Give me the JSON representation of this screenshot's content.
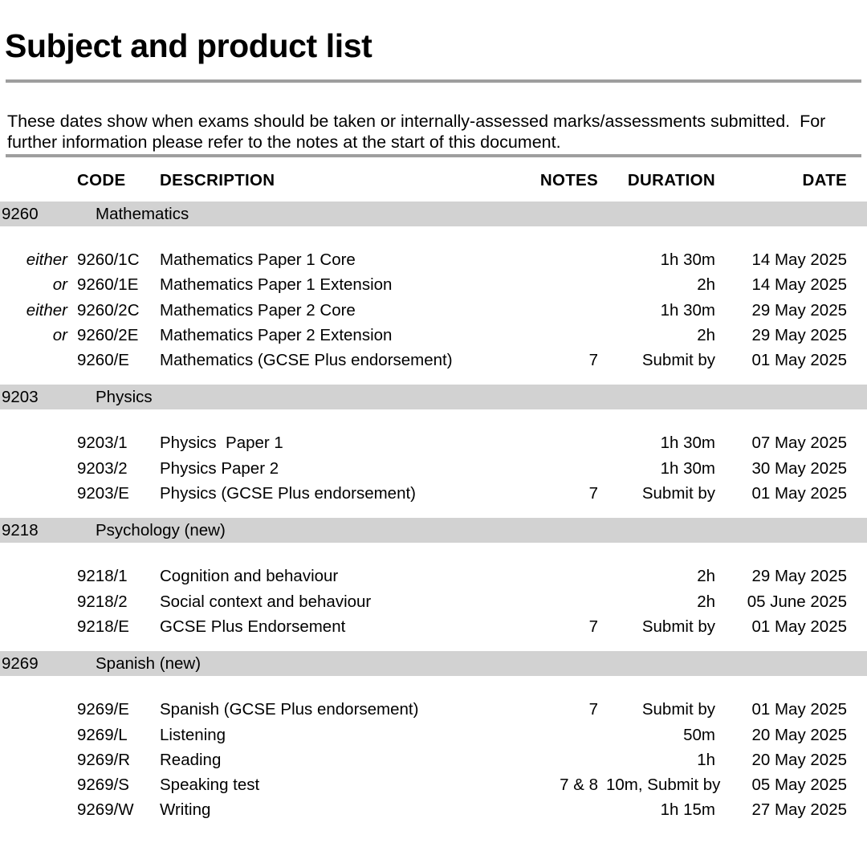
{
  "document": {
    "title": "Subject and product list",
    "intro": "These dates show when exams should be taken or internally-assessed marks/assessments submitted.  For further information please refer to the notes at the start of this document.",
    "band_color": "#d2d2d2",
    "rule_color": "#9e9e9e"
  },
  "table": {
    "headers": {
      "either": "",
      "code": "CODE",
      "description": "DESCRIPTION",
      "notes": "NOTES",
      "duration": "DURATION",
      "date": "DATE"
    },
    "sections": [
      {
        "subject_code": "9260",
        "subject_name": "Mathematics",
        "rows": [
          {
            "either": "either",
            "code": "9260/1C",
            "description": "Mathematics Paper 1 Core",
            "notes": "",
            "duration": "1h 30m",
            "date": "14 May 2025"
          },
          {
            "either": "or",
            "code": "9260/1E",
            "description": "Mathematics Paper 1 Extension",
            "notes": "",
            "duration": "2h",
            "date": "14 May 2025"
          },
          {
            "either": "either",
            "code": "9260/2C",
            "description": "Mathematics Paper 2 Core",
            "notes": "",
            "duration": "1h 30m",
            "date": "29 May 2025"
          },
          {
            "either": "or",
            "code": "9260/2E",
            "description": "Mathematics Paper 2 Extension",
            "notes": "",
            "duration": "2h",
            "date": "29 May 2025"
          },
          {
            "either": "",
            "code": "9260/E",
            "description": "Mathematics (GCSE Plus endorsement)",
            "notes": "7",
            "duration": "Submit by",
            "date": "01 May 2025"
          }
        ]
      },
      {
        "subject_code": "9203",
        "subject_name": "Physics",
        "rows": [
          {
            "either": "",
            "code": "9203/1",
            "description": "Physics  Paper 1",
            "notes": "",
            "duration": "1h 30m",
            "date": "07 May 2025"
          },
          {
            "either": "",
            "code": "9203/2",
            "description": "Physics Paper 2",
            "notes": "",
            "duration": "1h 30m",
            "date": "30 May 2025"
          },
          {
            "either": "",
            "code": "9203/E",
            "description": "Physics (GCSE Plus endorsement)",
            "notes": "7",
            "duration": "Submit by",
            "date": "01 May 2025"
          }
        ]
      },
      {
        "subject_code": "9218",
        "subject_name": "Psychology (new)",
        "rows": [
          {
            "either": "",
            "code": "9218/1",
            "description": "Cognition and behaviour",
            "notes": "",
            "duration": "2h",
            "date": "29 May 2025"
          },
          {
            "either": "",
            "code": "9218/2",
            "description": "Social context and behaviour",
            "notes": "",
            "duration": "2h",
            "date": "05 June 2025"
          },
          {
            "either": "",
            "code": "9218/E",
            "description": "GCSE Plus Endorsement",
            "notes": "7",
            "duration": "Submit by",
            "date": "01 May 2025"
          }
        ]
      },
      {
        "subject_code": "9269",
        "subject_name": "Spanish (new)",
        "rows": [
          {
            "either": "",
            "code": "9269/E",
            "description": "Spanish (GCSE Plus endorsement)",
            "notes": "7",
            "duration": "Submit by",
            "date": "01 May 2025"
          },
          {
            "either": "",
            "code": "9269/L",
            "description": "Listening",
            "notes": "",
            "duration": "50m",
            "date": "20 May 2025"
          },
          {
            "either": "",
            "code": "9269/R",
            "description": "Reading",
            "notes": "",
            "duration": "1h",
            "date": "20 May 2025"
          },
          {
            "either": "",
            "code": "9269/S",
            "description": "Speaking test",
            "notes": "7 & 8",
            "duration": "10m, Submit by",
            "date": "05 May 2025"
          },
          {
            "either": "",
            "code": "9269/W",
            "description": "Writing",
            "notes": "",
            "duration": "1h 15m",
            "date": "27 May 2025"
          }
        ]
      }
    ]
  }
}
